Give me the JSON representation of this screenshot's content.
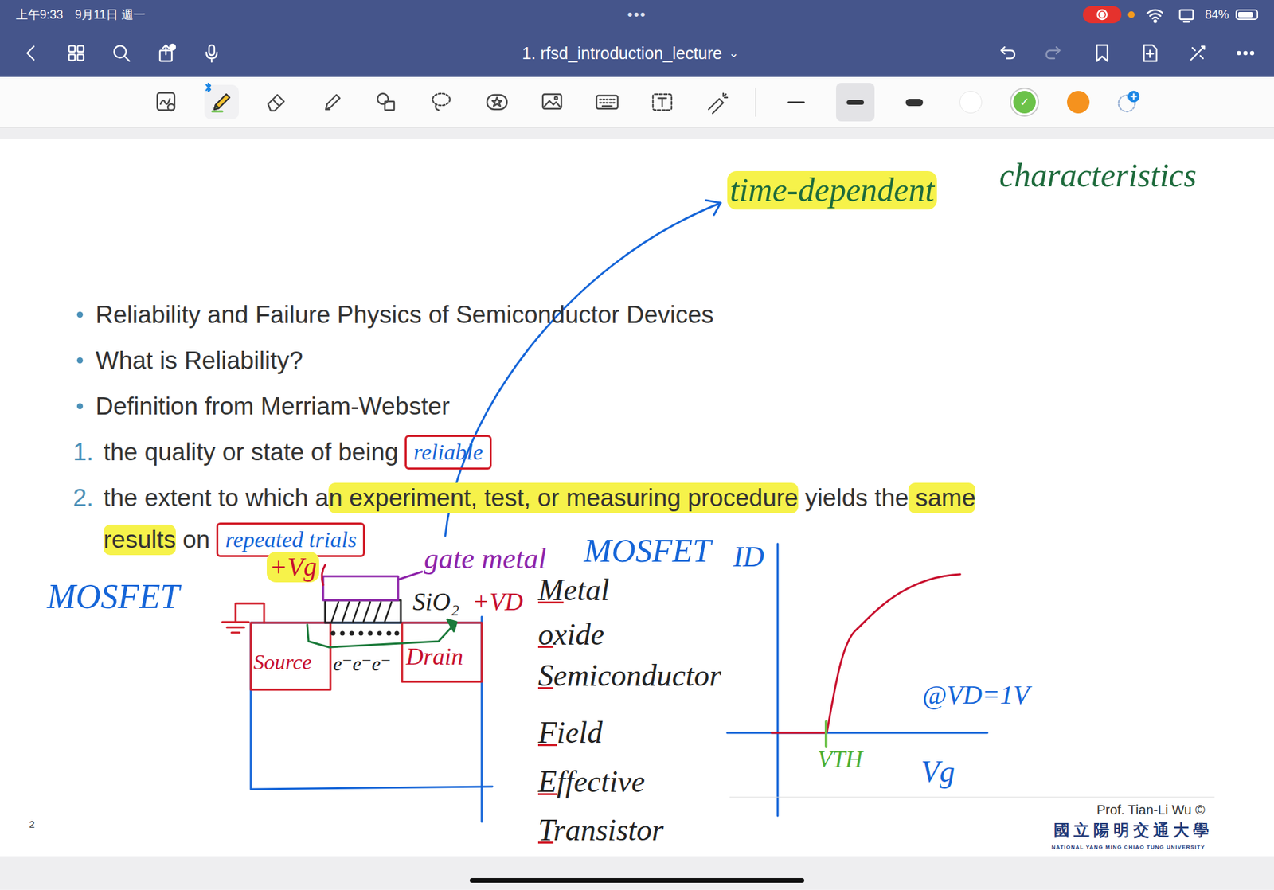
{
  "status_bar": {
    "time": "上午9:33",
    "date": "9月11日 週一",
    "center_dots": "•••",
    "recording": true,
    "battery": "84%",
    "battery_level": 0.84
  },
  "nav": {
    "title": "1. rfsd_introduction_lecture",
    "title_chevron": "⌄",
    "redo_disabled": true
  },
  "toolbar": {
    "tools": [
      {
        "kind": "zoom",
        "selected": false
      },
      {
        "kind": "pen",
        "selected": true
      },
      {
        "kind": "eraser",
        "selected": false
      },
      {
        "kind": "highlighter",
        "selected": false
      },
      {
        "kind": "shapes",
        "selected": false
      },
      {
        "kind": "lasso",
        "selected": false
      },
      {
        "kind": "sticker",
        "selected": false
      },
      {
        "kind": "image",
        "selected": false
      },
      {
        "kind": "keyboard",
        "selected": false
      },
      {
        "kind": "text",
        "selected": false
      },
      {
        "kind": "laser",
        "selected": false
      }
    ],
    "pen_widths": [
      {
        "selected": false
      },
      {
        "selected": true
      },
      {
        "selected": false
      }
    ],
    "colors": [
      {
        "color": "#ffffff",
        "selected": false
      },
      {
        "color": "#6cc24a",
        "selected": true
      },
      {
        "color": "#f5921e",
        "selected": false
      }
    ],
    "selected_check": "✓"
  },
  "slide": {
    "bullets": [
      "Reliability and Failure Physics of Semiconductor Devices",
      "What is Reliability?",
      "Definition from Merriam-Webster"
    ],
    "numbered": [
      {
        "number": "1.",
        "lines": [
          [
            {
              "text": "the quality or state of being",
              "highlighted": false
            }
          ]
        ],
        "note": "reliable"
      },
      {
        "number": "2.",
        "lines": [
          [
            {
              "text": "the extent to which a",
              "highlighted": false
            },
            {
              "text": "n experiment, test, or measuring procedure",
              "highlighted": true
            },
            {
              "text": " yields the",
              "highlighted": false
            },
            {
              "text": " same",
              "highlighted": true
            }
          ],
          [
            {
              "text": "results",
              "highlighted": true
            },
            {
              "text": " on",
              "highlighted": false
            }
          ]
        ],
        "note": "repeated trials"
      }
    ],
    "footer": {
      "author": "Prof. Tian-Li Wu ©",
      "university_zh": "國立陽明交通大學",
      "university_en": "NATIONAL YANG MING CHIAO TUNG UNIVERSITY",
      "page": "2"
    }
  },
  "annotations": [
    {
      "text": "time-dependent",
      "color": "#1e6b3c",
      "highlighted": true
    },
    {
      "text": "characteristics",
      "color": "#1e6b3c",
      "highlighted": false
    },
    {
      "text": "MOSFET",
      "color": "#1565d8",
      "highlighted": false
    },
    {
      "text": "+Vg",
      "color": "#c8102e",
      "highlighted": true
    },
    {
      "text": "gate metal",
      "color": "#8e24aa",
      "highlighted": false
    },
    {
      "text": "MOSFET",
      "color": "#1565d8",
      "highlighted": false
    },
    {
      "text": "SiO₂",
      "color": "#222222",
      "highlighted": false
    },
    {
      "text": "+VD",
      "color": "#c8102e",
      "highlighted": false
    },
    {
      "text": "Source",
      "color": "#c8102e",
      "highlighted": false
    },
    {
      "text": "Drain",
      "color": "#c8102e",
      "highlighted": false
    },
    {
      "text": "e⁻e⁻e⁻",
      "color": "#222222",
      "highlighted": false
    },
    {
      "text": "ID",
      "color": "#1565d8",
      "highlighted": false
    },
    {
      "text": "VTH",
      "color": "#4caf32",
      "highlighted": false
    },
    {
      "text": "Vg",
      "color": "#1565d8",
      "highlighted": false
    },
    {
      "text": "@VD=1V",
      "color": "#1565d8",
      "highlighted": false
    }
  ],
  "acronym": [
    "Metal",
    "oxide",
    "Semiconductor",
    "Field",
    "Effective",
    "Transistor"
  ]
}
